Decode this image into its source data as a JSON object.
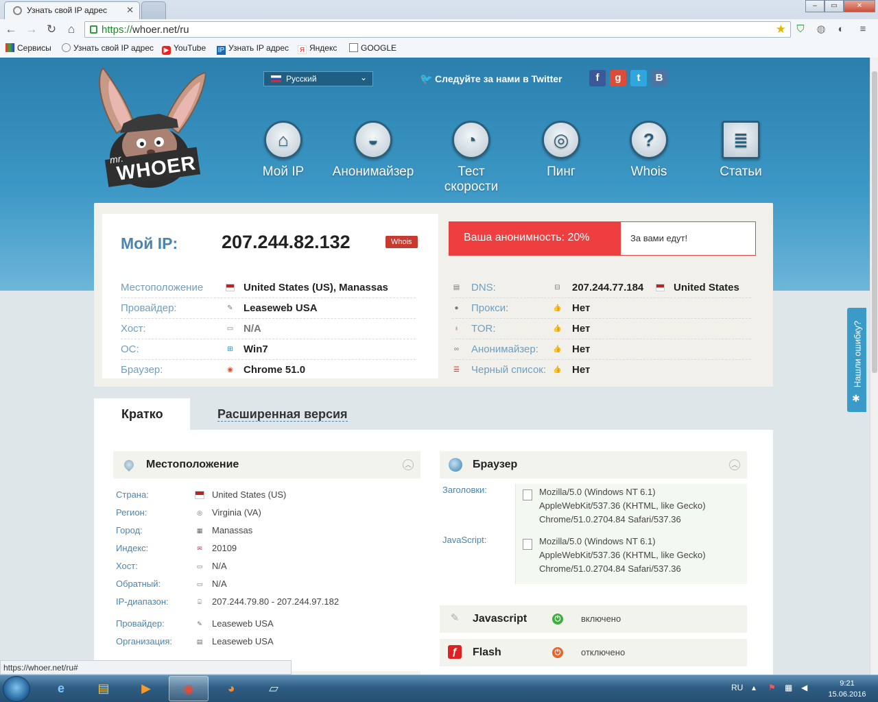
{
  "browser": {
    "tabs": [
      {
        "title": "Узнать свой IP адрес",
        "active": true
      },
      {
        "title": "",
        "active": false
      }
    ],
    "url_scheme": "https://",
    "url_rest": "whoer.net/ru",
    "bookmarks": [
      "Сервисы",
      "Узнать свой IP адрес",
      "YouTube",
      "Узнать IP адрес",
      "Яндекс",
      "GOOGLE"
    ],
    "status_url": "https://whoer.net/ru#"
  },
  "site": {
    "logo_small": "mr.",
    "logo_big": "WHOER",
    "language": "Русский",
    "twitter": "Следуйте за нами в Twitter",
    "social": [
      {
        "name": "facebook",
        "glyph": "f",
        "color": "#3b5998"
      },
      {
        "name": "google",
        "glyph": "g",
        "color": "#dd4b39"
      },
      {
        "name": "twitter",
        "glyph": "t",
        "color": "#2fa6dd"
      },
      {
        "name": "vkontakte",
        "glyph": "B",
        "color": "#4c75a3"
      }
    ],
    "nav": [
      "Мой IP",
      "Анонимайзер",
      "Тест скорости",
      "Пинг",
      "Whois",
      "Статьи"
    ]
  },
  "ip_card": {
    "label": "Мой IP:",
    "ip": "207.244.82.132",
    "whois": "Whois",
    "rows": [
      {
        "k": "Местоположение",
        "v": "United States (US), Manassas",
        "icon": "us-flag-icon"
      },
      {
        "k": "Провайдер:",
        "v": "Leaseweb USA",
        "icon": "provider-icon"
      },
      {
        "k": "Хост:",
        "v": "N/A",
        "icon": "host-icon"
      },
      {
        "k": "ОС:",
        "v": "Win7",
        "icon": "windows-icon"
      },
      {
        "k": "Браузер:",
        "v": "Chrome 51.0",
        "icon": "chrome-icon"
      }
    ],
    "anonymity": "Ваша анонимность: 20%",
    "anonymity_note": "За вами едут!",
    "checks": [
      {
        "k": "DNS:",
        "v": "207.244.77.184",
        "extra": "United States"
      },
      {
        "k": "Прокси:",
        "v": "Нет"
      },
      {
        "k": "TOR:",
        "v": "Нет"
      },
      {
        "k": "Анонимайзер:",
        "v": "Нет"
      },
      {
        "k": "Черный список:",
        "v": "Нет"
      }
    ]
  },
  "tabs": {
    "short": "Кратко",
    "extended": "Расширенная версия"
  },
  "location": {
    "title": "Местоположение",
    "rows": [
      {
        "k": "Страна:",
        "v": "United States (US)"
      },
      {
        "k": "Регион:",
        "v": "Virginia (VA)"
      },
      {
        "k": "Город:",
        "v": "Manassas"
      },
      {
        "k": "Индекс:",
        "v": "20109"
      },
      {
        "k": "Хост:",
        "v": "N/A"
      },
      {
        "k": "Обратный:",
        "v": "N/A"
      },
      {
        "k": "IP-диапазон:",
        "v": "207.244.79.80 - 207.244.97.182"
      },
      {
        "k": "Провайдер:",
        "v": "Leaseweb USA"
      },
      {
        "k": "Организация:",
        "v": "Leaseweb USA"
      }
    ]
  },
  "browser_info": {
    "title": "Браузер",
    "headers_label": "Заголовки:",
    "headers_lines": [
      "Mozilla/5.0 (Windows NT 6.1)",
      "AppleWebKit/537.36 (KHTML, like Gecko)",
      "Chrome/51.0.2704.84 Safari/537.36"
    ],
    "js_label": "JavaScript:",
    "js_lines": [
      "Mozilla/5.0 (Windows NT 6.1)",
      "AppleWebKit/537.36 (KHTML, like Gecko)",
      "Chrome/51.0.2704.84 Safari/537.36"
    ],
    "javascript": {
      "label": "Javascript",
      "status": "включено",
      "color": "#3fae3f"
    },
    "flash": {
      "label": "Flash",
      "status": "отключено",
      "color": "#e3662b"
    }
  },
  "feedback": "Нашли ошибку?",
  "taskbar": {
    "lang": "RU",
    "time": "9:21",
    "date": "15.06.2016"
  }
}
